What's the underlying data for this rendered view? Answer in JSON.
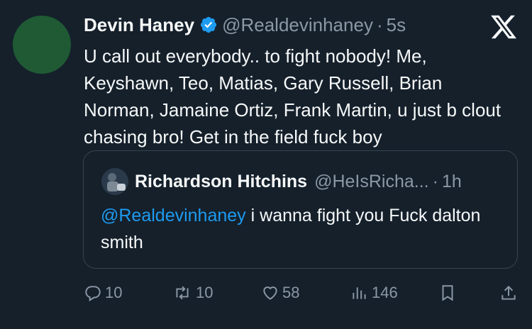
{
  "tweet": {
    "author_name": "Devin Haney",
    "handle": "@Realdevinhaney",
    "separator": "·",
    "time": "5s",
    "text": "U call out everybody.. to fight nobody! Me, Keyshawn, Teo, Matias, Gary Russell, Brian Norman, Jamaine Ortiz, Frank Martin, u just b clout chasing bro! Get in the field fuck boy"
  },
  "quote": {
    "author_name": "Richardson Hitchins",
    "handle": "@HeIsRicha...",
    "separator": "·",
    "time": "1h",
    "mention": "@Realdevinhaney",
    "text": " i wanna fight you Fuck dalton smith"
  },
  "actions": {
    "replies": "10",
    "reposts": "10",
    "likes": "58",
    "views": "146"
  },
  "colors": {
    "background": "#15202b",
    "link": "#1d9bf0",
    "muted": "#8b98a5"
  },
  "icons": [
    "x-logo-icon",
    "verified-badge-icon",
    "reply-icon",
    "repost-icon",
    "like-icon",
    "views-icon",
    "bookmark-icon",
    "share-icon"
  ]
}
